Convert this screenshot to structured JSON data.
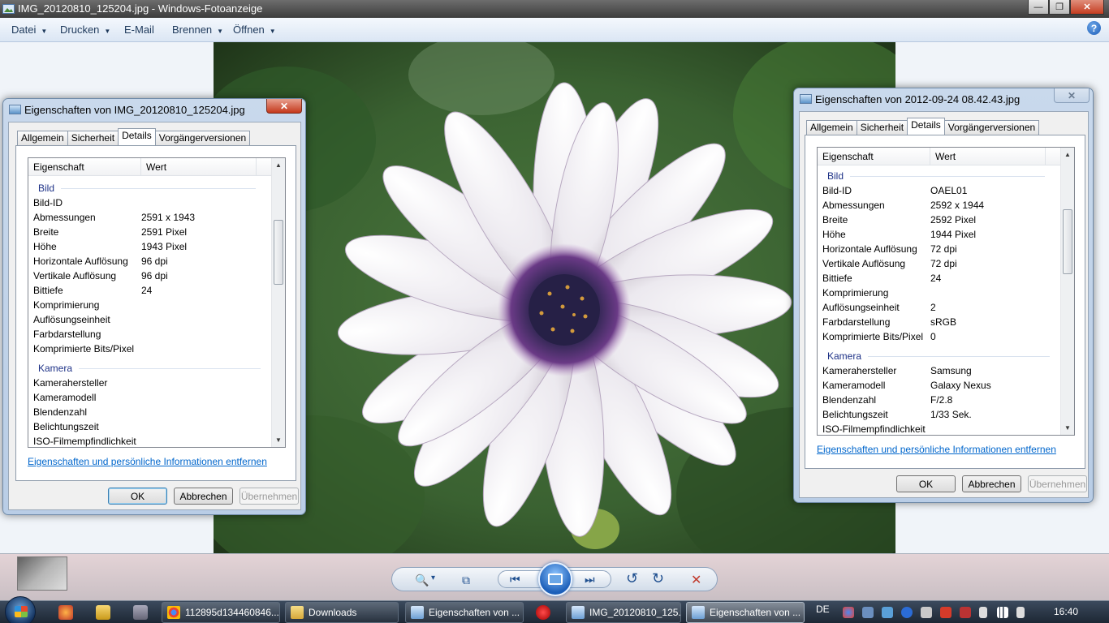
{
  "window": {
    "title": "IMG_20120810_125204.jpg - Windows-Fotoanzeige",
    "buttons": {
      "minimize": "—",
      "maximize": "❐",
      "close": "✕"
    }
  },
  "menu": {
    "items": [
      {
        "label": "Datei",
        "has_caret": true
      },
      {
        "label": "Drucken",
        "has_caret": true
      },
      {
        "label": "E-Mail",
        "has_caret": false
      },
      {
        "label": "Brennen",
        "has_caret": true
      },
      {
        "label": "Öffnen",
        "has_caret": true
      }
    ],
    "caret": "▼",
    "help": "?"
  },
  "left_dialog": {
    "title": "Eigenschaften von IMG_20120810_125204.jpg",
    "close": "✕",
    "tabs": [
      "Allgemein",
      "Sicherheit",
      "Details",
      "Vorgängerversionen"
    ],
    "active_tab": "Details",
    "header": {
      "property": "Eigenschaft",
      "value": "Wert"
    },
    "group_bild": "Bild",
    "group_kamera": "Kamera",
    "rows_bild": [
      {
        "k": "Bild-ID",
        "v": ""
      },
      {
        "k": "Abmessungen",
        "v": "2591 x 1943"
      },
      {
        "k": "Breite",
        "v": "2591 Pixel"
      },
      {
        "k": "Höhe",
        "v": "1943 Pixel"
      },
      {
        "k": "Horizontale Auflösung",
        "v": "96 dpi"
      },
      {
        "k": "Vertikale Auflösung",
        "v": "96 dpi"
      },
      {
        "k": "Bittiefe",
        "v": "24"
      },
      {
        "k": "Komprimierung",
        "v": ""
      },
      {
        "k": "Auflösungseinheit",
        "v": ""
      },
      {
        "k": "Farbdarstellung",
        "v": ""
      },
      {
        "k": "Komprimierte Bits/Pixel",
        "v": ""
      }
    ],
    "rows_kamera": [
      {
        "k": "Kamerahersteller",
        "v": ""
      },
      {
        "k": "Kameramodell",
        "v": ""
      },
      {
        "k": "Blendenzahl",
        "v": ""
      },
      {
        "k": "Belichtungszeit",
        "v": ""
      },
      {
        "k": "ISO-Filmempfindlichkeit",
        "v": ""
      }
    ],
    "link": "Eigenschaften und persönliche Informationen entfernen",
    "ok": "OK",
    "cancel": "Abbrechen",
    "apply": "Übernehmen"
  },
  "right_dialog": {
    "title": "Eigenschaften von 2012-09-24 08.42.43.jpg",
    "close": "✕",
    "tabs": [
      "Allgemein",
      "Sicherheit",
      "Details",
      "Vorgängerversionen"
    ],
    "active_tab": "Details",
    "header": {
      "property": "Eigenschaft",
      "value": "Wert"
    },
    "group_bild": "Bild",
    "group_kamera": "Kamera",
    "rows_bild": [
      {
        "k": "Bild-ID",
        "v": "OAEL01"
      },
      {
        "k": "Abmessungen",
        "v": "2592 x 1944"
      },
      {
        "k": "Breite",
        "v": "2592 Pixel"
      },
      {
        "k": "Höhe",
        "v": "1944 Pixel"
      },
      {
        "k": "Horizontale Auflösung",
        "v": "72 dpi"
      },
      {
        "k": "Vertikale Auflösung",
        "v": "72 dpi"
      },
      {
        "k": "Bittiefe",
        "v": "24"
      },
      {
        "k": "Komprimierung",
        "v": ""
      },
      {
        "k": "Auflösungseinheit",
        "v": "2"
      },
      {
        "k": "Farbdarstellung",
        "v": "sRGB"
      },
      {
        "k": "Komprimierte Bits/Pixel",
        "v": "0"
      }
    ],
    "rows_kamera": [
      {
        "k": "Kamerahersteller",
        "v": "Samsung"
      },
      {
        "k": "Kameramodell",
        "v": "Galaxy Nexus"
      },
      {
        "k": "Blendenzahl",
        "v": "F/2.8"
      },
      {
        "k": "Belichtungszeit",
        "v": "1/33 Sek."
      },
      {
        "k": "ISO-Filmempfindlichkeit",
        "v": ""
      }
    ],
    "link": "Eigenschaften und persönliche Informationen entfernen",
    "ok": "OK",
    "cancel": "Abbrechen",
    "apply": "Übernehmen"
  },
  "controls": {
    "zoom_icon": "🔍",
    "caret": "▾",
    "fit_icon": "⧉",
    "prev_icon": "⏮",
    "next_icon": "⏭",
    "rotate_left_icon": "↺",
    "rotate_right_icon": "↻",
    "delete_icon": "✕"
  },
  "taskbar": {
    "items": [
      {
        "label": "112895d134460846...",
        "color": "#e0a12a"
      },
      {
        "label": "Downloads",
        "color": "#e9c45a"
      },
      {
        "label": "Eigenschaften von ...",
        "color": "#7aa7d6"
      },
      {
        "label": "IMG_20120810_125...",
        "color": "#7aa7d6"
      },
      {
        "label": "Eigenschaften von ...",
        "color": "#7aa7d6"
      }
    ],
    "language": "DE",
    "clock": "16:40"
  }
}
